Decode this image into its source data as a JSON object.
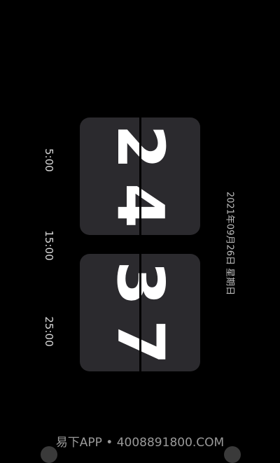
{
  "clock": {
    "hours": [
      "2",
      "4"
    ],
    "minutes": [
      "3",
      "7"
    ]
  },
  "timers": [
    {
      "label": "5:00"
    },
    {
      "label": "15:00"
    },
    {
      "label": "25:00"
    }
  ],
  "date": "2021年09月26日 星期日",
  "watermark": "易下APP • 4008891800.COM",
  "colors": {
    "background": "#000000",
    "card": "#2b2a2e",
    "digit": "#ffffff",
    "muted_text": "#d8d8d8"
  },
  "icons": {
    "bottom_left": "settings-gear-icon",
    "bottom_right": "theme-icon"
  }
}
